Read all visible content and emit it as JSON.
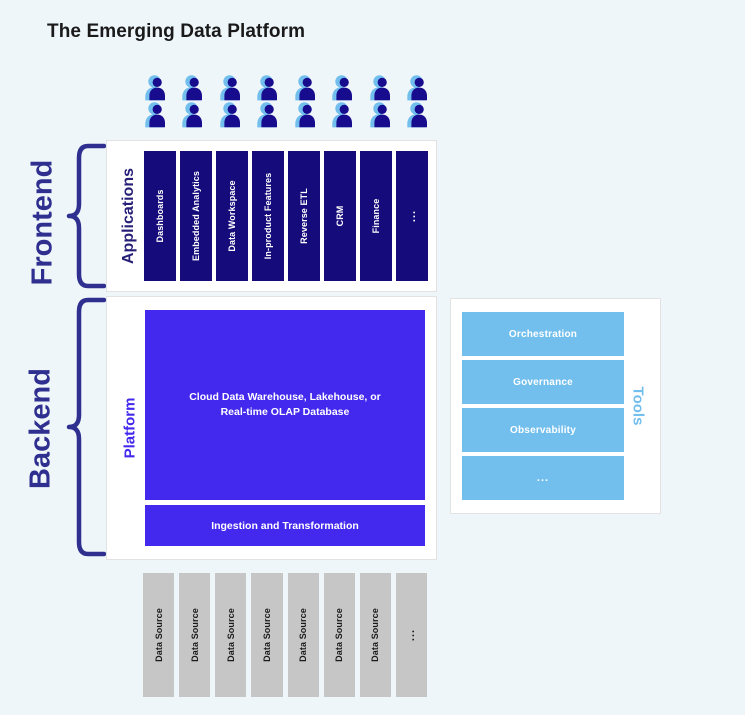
{
  "title": "The Emerging Data Platform",
  "colors": {
    "background": "#eef6fa",
    "navy": "#150b7a",
    "platform_blue": "#4328ee",
    "tools_blue": "#72bfee",
    "source_gray": "#c6c6c6",
    "brace": "#2f2f8f",
    "title_text": "#1a1a1a",
    "user_icon_light": "#72bfee",
    "user_icon_dark": "#170b8e"
  },
  "users": {
    "icon_name": "user-group-icon",
    "columns": 8,
    "rows": 2,
    "total": 16
  },
  "tiers": {
    "frontend": {
      "label": "Frontend",
      "brace_name": "frontend-brace"
    },
    "backend": {
      "label": "Backend",
      "brace_name": "backend-brace"
    }
  },
  "applications": {
    "label": "Applications",
    "boxes": [
      {
        "label": "Dashboards",
        "ellipsis": false
      },
      {
        "label": "Embedded Analytics",
        "ellipsis": false
      },
      {
        "label": "Data Workspace",
        "ellipsis": false
      },
      {
        "label": "In-product Features",
        "ellipsis": false
      },
      {
        "label": "Reverse ETL",
        "ellipsis": false
      },
      {
        "label": "CRM",
        "ellipsis": false
      },
      {
        "label": "Finance",
        "ellipsis": false
      },
      {
        "label": "...",
        "ellipsis": true
      }
    ]
  },
  "platform": {
    "label": "Platform",
    "warehouse": {
      "line1": "Cloud Data Warehouse, Lakehouse, or",
      "line2": "Real-time OLAP Database"
    },
    "ingestion": {
      "label": "Ingestion and Transformation"
    }
  },
  "tools": {
    "label": "Tools",
    "boxes": [
      {
        "label": "Orchestration",
        "ellipsis": false
      },
      {
        "label": "Governance",
        "ellipsis": false
      },
      {
        "label": "Observability",
        "ellipsis": false
      },
      {
        "label": "...",
        "ellipsis": true
      }
    ]
  },
  "data_sources": {
    "boxes": [
      {
        "label": "Data Source",
        "ellipsis": false
      },
      {
        "label": "Data Source",
        "ellipsis": false
      },
      {
        "label": "Data Source",
        "ellipsis": false
      },
      {
        "label": "Data Source",
        "ellipsis": false
      },
      {
        "label": "Data Source",
        "ellipsis": false
      },
      {
        "label": "Data Source",
        "ellipsis": false
      },
      {
        "label": "Data Source",
        "ellipsis": false
      },
      {
        "label": "...",
        "ellipsis": true
      }
    ]
  }
}
